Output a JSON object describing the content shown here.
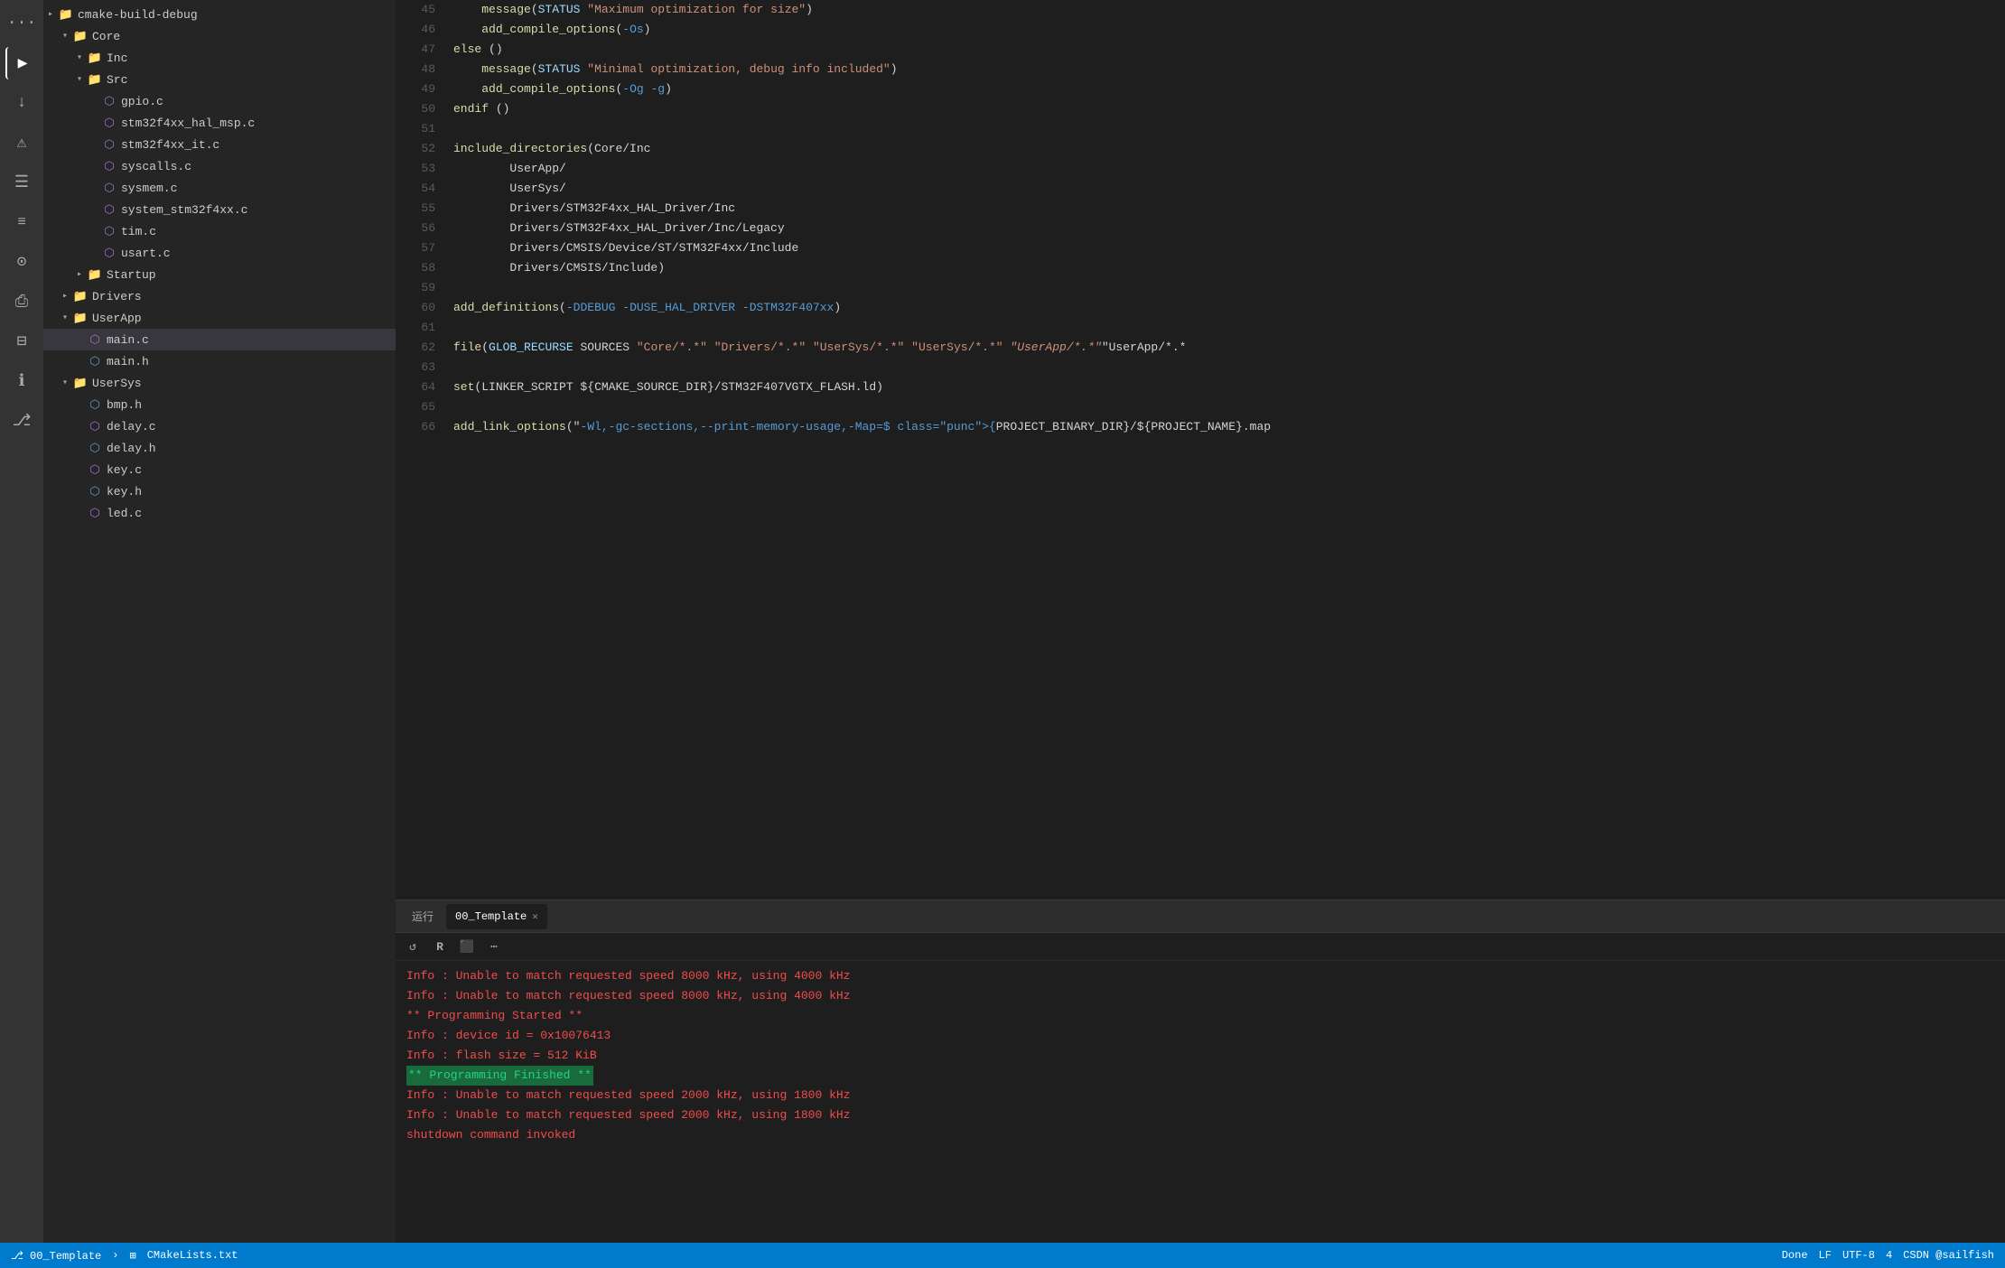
{
  "sidebar": {
    "items": [
      {
        "id": "cmake-build-debug",
        "label": "cmake-build-debug",
        "type": "folder",
        "indent": 0,
        "state": "closed"
      },
      {
        "id": "Core",
        "label": "Core",
        "type": "folder",
        "indent": 1,
        "state": "open"
      },
      {
        "id": "Inc",
        "label": "Inc",
        "type": "folder",
        "indent": 2,
        "state": "open"
      },
      {
        "id": "Src",
        "label": "Src",
        "type": "folder",
        "indent": 2,
        "state": "open"
      },
      {
        "id": "gpio.c",
        "label": "gpio.c",
        "type": "file-c",
        "indent": 3
      },
      {
        "id": "stm32f4xx_hal_msp.c",
        "label": "stm32f4xx_hal_msp.c",
        "type": "file-c",
        "indent": 3
      },
      {
        "id": "stm32f4xx_it.c",
        "label": "stm32f4xx_it.c",
        "type": "file-c",
        "indent": 3
      },
      {
        "id": "syscalls.c",
        "label": "syscalls.c",
        "type": "file-c",
        "indent": 3
      },
      {
        "id": "sysmem.c",
        "label": "sysmem.c",
        "type": "file-c",
        "indent": 3
      },
      {
        "id": "system_stm32f4xx.c",
        "label": "system_stm32f4xx.c",
        "type": "file-c",
        "indent": 3
      },
      {
        "id": "tim.c",
        "label": "tim.c",
        "type": "file-c",
        "indent": 3
      },
      {
        "id": "usart.c",
        "label": "usart.c",
        "type": "file-c",
        "indent": 3
      },
      {
        "id": "Startup",
        "label": "Startup",
        "type": "folder",
        "indent": 2,
        "state": "closed"
      },
      {
        "id": "Drivers",
        "label": "Drivers",
        "type": "folder",
        "indent": 1,
        "state": "closed"
      },
      {
        "id": "UserApp",
        "label": "UserApp",
        "type": "folder",
        "indent": 1,
        "state": "open"
      },
      {
        "id": "main.c",
        "label": "main.c",
        "type": "file-c",
        "indent": 2,
        "selected": true
      },
      {
        "id": "main.h",
        "label": "main.h",
        "type": "file-h",
        "indent": 2
      },
      {
        "id": "UserSys",
        "label": "UserSys",
        "type": "folder",
        "indent": 1,
        "state": "open"
      },
      {
        "id": "bmp.h",
        "label": "bmp.h",
        "type": "file-h",
        "indent": 2
      },
      {
        "id": "delay.c",
        "label": "delay.c",
        "type": "file-c",
        "indent": 2
      },
      {
        "id": "delay.h",
        "label": "delay.h",
        "type": "file-h",
        "indent": 2
      },
      {
        "id": "key.c",
        "label": "key.c",
        "type": "file-c",
        "indent": 2
      },
      {
        "id": "key.h",
        "label": "key.h",
        "type": "file-h",
        "indent": 2
      },
      {
        "id": "led.c",
        "label": "led.c",
        "type": "file-c",
        "indent": 2
      }
    ]
  },
  "editor": {
    "lines": [
      {
        "num": 45,
        "code": "    message(STATUS \"Maximum optimization for size\")"
      },
      {
        "num": 46,
        "code": "    add_compile_options(-Os)"
      },
      {
        "num": 47,
        "code": "else ()"
      },
      {
        "num": 48,
        "code": "    message(STATUS \"Minimal optimization, debug info included\")"
      },
      {
        "num": 49,
        "code": "    add_compile_options(-Og -g)"
      },
      {
        "num": 50,
        "code": "endif ()"
      },
      {
        "num": 51,
        "code": ""
      },
      {
        "num": 52,
        "code": "include_directories(Core/Inc"
      },
      {
        "num": 53,
        "code": "        UserApp/"
      },
      {
        "num": 54,
        "code": "        UserSys/"
      },
      {
        "num": 55,
        "code": "        Drivers/STM32F4xx_HAL_Driver/Inc"
      },
      {
        "num": 56,
        "code": "        Drivers/STM32F4xx_HAL_Driver/Inc/Legacy"
      },
      {
        "num": 57,
        "code": "        Drivers/CMSIS/Device/ST/STM32F4xx/Include"
      },
      {
        "num": 58,
        "code": "        Drivers/CMSIS/Include)"
      },
      {
        "num": 59,
        "code": ""
      },
      {
        "num": 60,
        "code": "add_definitions(-DDEBUG -DUSE_HAL_DRIVER -DSTM32F407xx)"
      },
      {
        "num": 61,
        "code": ""
      },
      {
        "num": 62,
        "code": "file(GLOB_RECURSE SOURCES \"Core/*.*\" \"Drivers/*.*\" \"UserSys/*.*\" \"UserSys/*.*\" \"UserApp/*.*\"\"UserApp/*.*"
      },
      {
        "num": 63,
        "code": ""
      },
      {
        "num": 64,
        "code": "set(LINKER_SCRIPT ${CMAKE_SOURCE_DIR}/STM32F407VGTX_FLASH.ld)"
      },
      {
        "num": 65,
        "code": ""
      },
      {
        "num": 66,
        "code": "add_link_options(\"-Wl,-gc-sections,--print-memory-usage,-Map=${PROJECT_BINARY_DIR}/${PROJECT_NAME}.map"
      }
    ]
  },
  "terminal": {
    "run_label": "运行",
    "tab_label": "00_Template",
    "output_lines": [
      {
        "text": "Info : Unable to match requested speed 8000 kHz, using 4000 kHz",
        "class": "t-red"
      },
      {
        "text": "Info : Unable to match requested speed 8000 kHz, using 4000 kHz",
        "class": "t-red"
      },
      {
        "text": "** Programming Started **",
        "class": "t-red"
      },
      {
        "text": "Info : device id = 0x10076413",
        "class": "t-red"
      },
      {
        "text": "Info : flash size = 512 KiB",
        "class": "t-red"
      },
      {
        "text": "** Programming Finished **",
        "class": "t-highlight"
      },
      {
        "text": "Info : Unable to match requested speed 2000 kHz, using 1800 kHz",
        "class": "t-red"
      },
      {
        "text": "Info : Unable to match requested speed 2000 kHz, using 1800 kHz",
        "class": "t-red"
      },
      {
        "text": "shutdown command invoked",
        "class": "t-red"
      }
    ]
  },
  "statusbar": {
    "left": {
      "branch": "00_Template",
      "breadcrumb": "CMakeLists.txt"
    },
    "right": {
      "done": "Done",
      "lf": "LF",
      "encoding": "UTF-8",
      "spaces": "4",
      "user": "CSDN @sailfish"
    }
  },
  "activity": {
    "icons": [
      {
        "name": "more-icon",
        "symbol": "···"
      },
      {
        "name": "run-icon",
        "symbol": "▶"
      },
      {
        "name": "down-arrow-icon",
        "symbol": "↓"
      },
      {
        "name": "warning-icon",
        "symbol": "⚠"
      },
      {
        "name": "list-icon",
        "symbol": "☰"
      },
      {
        "name": "list2-icon",
        "symbol": "≡"
      },
      {
        "name": "debug-icon",
        "symbol": "⊙"
      },
      {
        "name": "print-icon",
        "symbol": "⎙"
      },
      {
        "name": "bookmark-icon",
        "symbol": "⊟"
      },
      {
        "name": "info-icon",
        "symbol": "ℹ"
      },
      {
        "name": "git-icon",
        "symbol": "⎇"
      }
    ]
  }
}
